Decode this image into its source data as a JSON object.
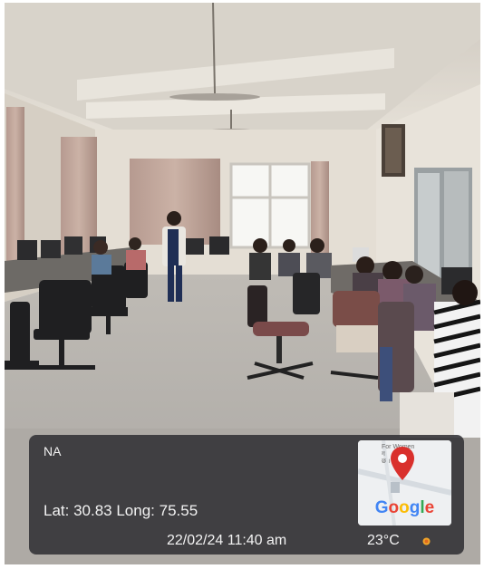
{
  "overlay": {
    "location": "NA",
    "coords": "Lat: 30.83  Long: 75.55",
    "datetime": "22/02/24 11:40 am",
    "temperature": "23°C",
    "weather_icon": "sun-icon",
    "map_icon": "map-pin-icon",
    "map_text_line1": "For Women",
    "map_text_line2": "ग",
    "map_text_line3": "छ ।",
    "google_logo": "Google",
    "pin_color": "#d9302c",
    "overlay_color": "#2d2d32"
  }
}
